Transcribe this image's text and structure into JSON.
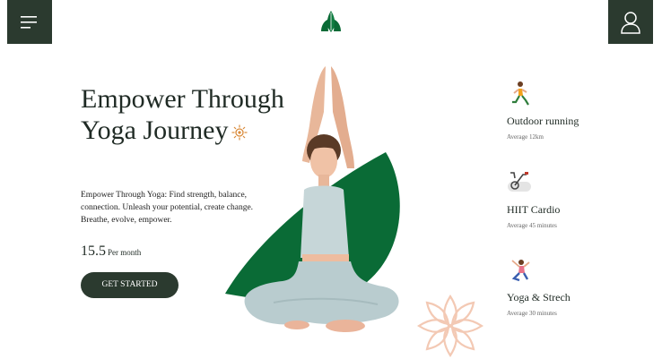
{
  "header": {
    "menu_icon": "hamburger-menu-icon",
    "logo_icon": "praying-hands-lotus-logo",
    "user_icon": "user-profile-icon"
  },
  "hero": {
    "title": "Empower Through Yoga Journey",
    "title_icon": "sun-mandala-icon",
    "description": "Empower Through Yoga: Find strength, balance, connection. Unleash your potential, create change. Breathe, evolve, empower.",
    "price": "15.5",
    "price_unit": "Per month",
    "cta_label": "GET STARTED"
  },
  "features": [
    {
      "icon": "running-person-icon",
      "title": "Outdoor running",
      "subtitle": "Average 12km"
    },
    {
      "icon": "exercise-bike-icon",
      "title": "HIIT Cardio",
      "subtitle": "Average 45 minutes"
    },
    {
      "icon": "yoga-pose-person-icon",
      "title": "Yoga & Strech",
      "subtitle": "Average 30 minutes"
    }
  ],
  "colors": {
    "dark_green": "#2b3a2f",
    "brand_green": "#0a6b36",
    "lotus_peach": "#f3c9b4"
  }
}
